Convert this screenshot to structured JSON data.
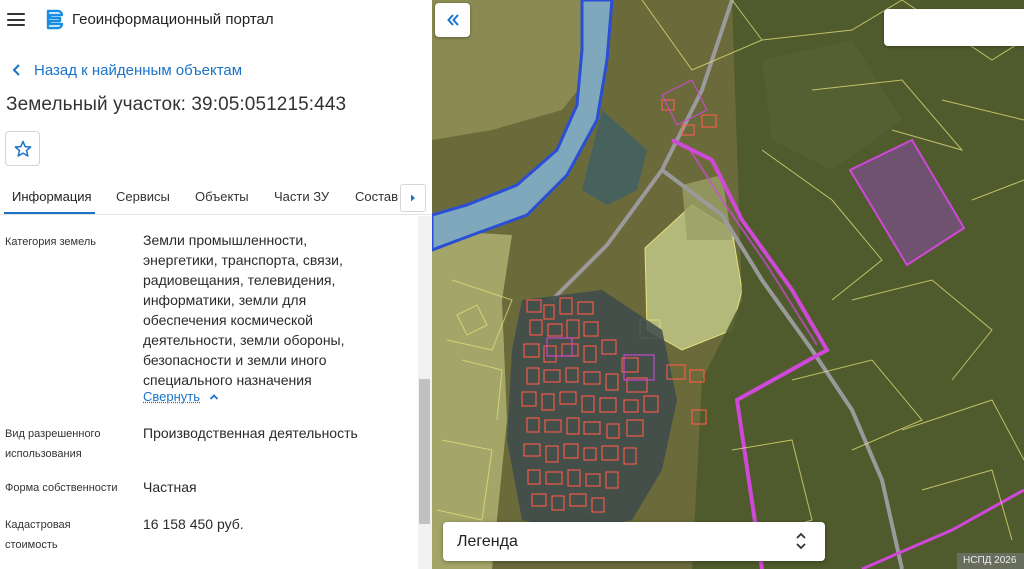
{
  "header": {
    "app_title": "Геоинформационный портал"
  },
  "nav": {
    "back_label": "Назад к найденным объектам"
  },
  "object": {
    "title": "Земельный участок: 39:05:051215:443"
  },
  "tabs": [
    {
      "label": "Информация"
    },
    {
      "label": "Сервисы"
    },
    {
      "label": "Объекты"
    },
    {
      "label": "Части ЗУ"
    },
    {
      "label": "Состав"
    }
  ],
  "fields": {
    "category": {
      "label": "Категория земель",
      "value_lines": [
        "Земли промышленности,",
        "энергетики, транспорта, связи,",
        "радиовещания, телевидения,",
        "информатики, земли для",
        "обеспечения космической",
        "деятельности, земли обороны,",
        "безопасности и земли иного",
        "специального назначения"
      ],
      "collapse_label": "Свернуть"
    },
    "permitted_use": {
      "label_lines": [
        "Вид разрешенного",
        "использования"
      ],
      "value": "Производственная деятельность"
    },
    "ownership": {
      "label": "Форма собственности",
      "value": "Частная"
    },
    "cadastral_value": {
      "label_lines": [
        "Кадастровая",
        "стоимость"
      ],
      "value": "16 158 450 руб."
    }
  },
  "map": {
    "legend_label": "Легенда",
    "attribution": "НСПД 2026"
  },
  "colors": {
    "accent": "#1a73c8",
    "parcel_outline": "#e8e07a",
    "selected_parcel": "#d048d8",
    "building_outline": "#ff5a4a"
  },
  "icons": {
    "menu": "hamburger-icon",
    "logo": "portal-logo-icon",
    "back": "chevron-left-icon",
    "favorite": "star-icon",
    "tab_scroll": "chevron-right-icon",
    "collapse": "chevron-up-icon",
    "panel_collapse": "double-chevron-left-icon",
    "legend_toggle": "unfold-icon"
  }
}
